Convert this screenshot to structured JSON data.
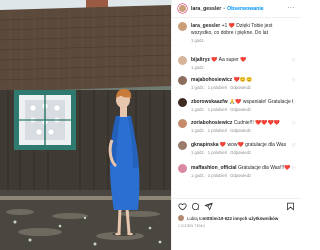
{
  "header": {
    "username": "lara_gessler",
    "separator": "•",
    "follow_label": "Obserwowanie",
    "more": "···"
  },
  "colors": {
    "accent": "#0095f6",
    "heart": "#ed4956",
    "meta": "#8e8e8e"
  },
  "comments": [
    {
      "user": "lara_gessler",
      "text": "+1 ❤️ Dzięki Tobie jest wszystko, co dobre i piękne. Do lat @jacob.szekup 🤍 #rodzic1",
      "meta": [
        "1 godz."
      ],
      "show_like": false,
      "avatar_color": "#c9a07a"
    },
    {
      "user": "bijaltryz",
      "text": "❤️ Aa super ❤️",
      "meta": [
        "1 godz."
      ],
      "show_like": true,
      "avatar_color": "#d6b49a"
    },
    {
      "user": "majabohosiewicz",
      "text": "❤️😊😊",
      "meta": [
        "1 godz.",
        "1 polubień",
        "Odpowiedz"
      ],
      "show_like": true,
      "avatar_color": "#8a6d5a"
    },
    {
      "user": "zborowskaazfw",
      "text": "🙏❤️ wspaniale! Gratulacje kocha",
      "meta": [
        "1 godz.",
        "1 polubień",
        "Odpowiedz"
      ],
      "show_like": true,
      "avatar_color": "#3d2b22"
    },
    {
      "user": "zoriabohosiewicz",
      "text": "Cudnie!!! ❤️❤️❤️❤️",
      "meta": [
        "1 godz.",
        "1 polubień",
        "Odpowiedz"
      ],
      "show_like": true,
      "avatar_color": "#c58b6b"
    },
    {
      "user": "gknapinska",
      "text": "❤️ wow❤️ gratulacje dla Was",
      "meta": [
        "1 godz.",
        "1 polubień",
        "Odpowiedz"
      ],
      "show_like": true,
      "avatar_color": "#9a7c6a"
    },
    {
      "user": "maffashion_official",
      "text": "Gratulacje dla Was!!!❤️",
      "meta": [
        "1 godz.",
        "1 polubień",
        "Odpowiedz"
      ],
      "show_like": true,
      "avatar_color": "#d98aa0"
    }
  ],
  "action_icons": [
    "heart-icon",
    "comment-icon",
    "share-icon",
    "bookmark-icon"
  ],
  "likes": {
    "prefix": "Lubią to ",
    "user": "mttttim",
    "middle": " i ",
    "count": "19 622 innych użytkowników"
  },
  "date": "1 DZIEŃ TEMU"
}
